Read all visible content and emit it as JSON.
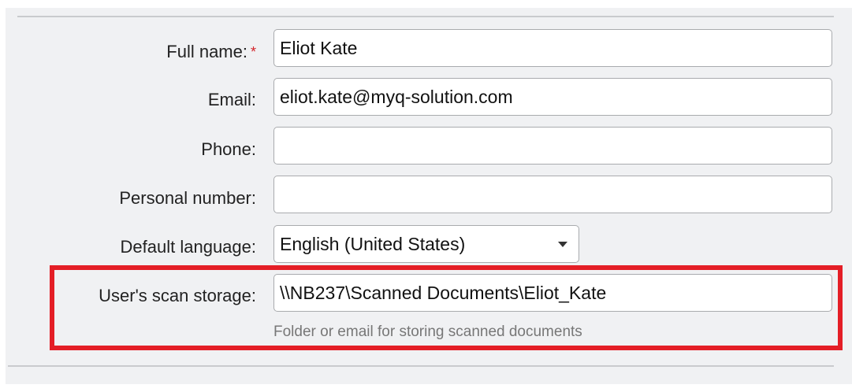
{
  "form": {
    "full_name": {
      "label": "Full name:",
      "required_mark": "*",
      "value": "Eliot Kate"
    },
    "email": {
      "label": "Email:",
      "value": "eliot.kate@myq-solution.com"
    },
    "phone": {
      "label": "Phone:",
      "value": ""
    },
    "personal_number": {
      "label": "Personal number:",
      "value": ""
    },
    "default_language": {
      "label": "Default language:",
      "value": "English (United States)"
    },
    "scan_storage": {
      "label": "User's scan storage:",
      "value": "\\\\NB237\\Scanned Documents\\Eliot_Kate",
      "help": "Folder or email for storing scanned documents"
    }
  },
  "colors": {
    "highlight": "#e41e26",
    "required": "#d3232a"
  }
}
